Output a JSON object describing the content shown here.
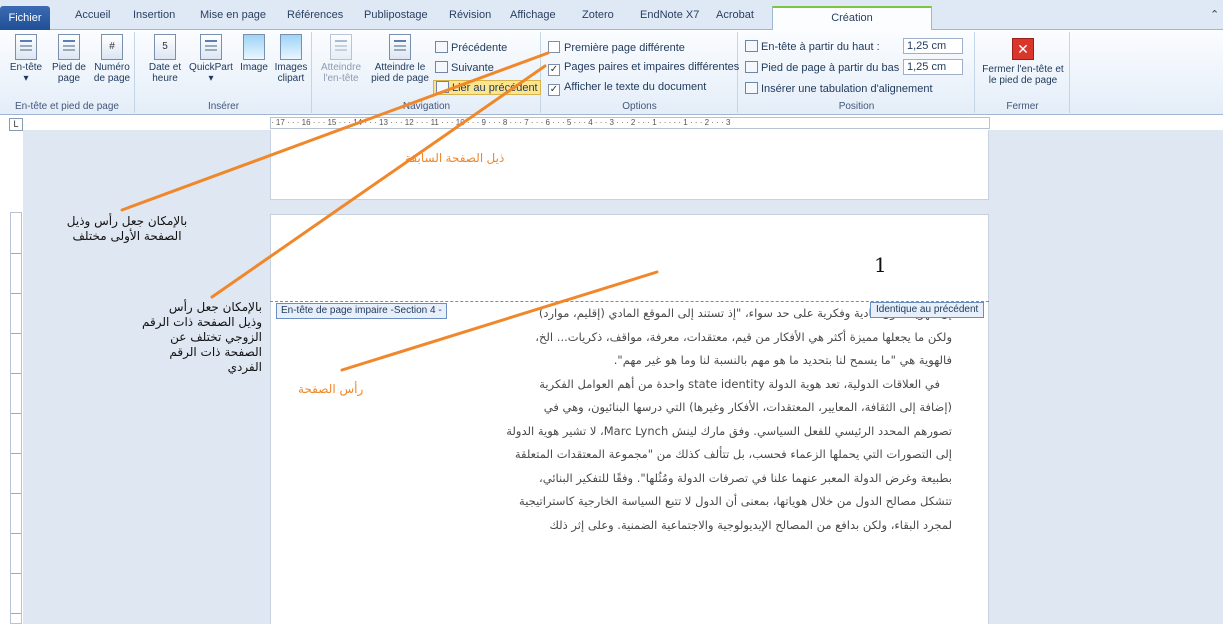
{
  "tabs": {
    "file": "Fichier",
    "items": [
      "Accueil",
      "Insertion",
      "Mise en page",
      "Références",
      "Publipostage",
      "Révision",
      "Affichage",
      "Zotero",
      "EndNote X7",
      "Acrobat"
    ],
    "active": "Création"
  },
  "ribbon": {
    "group_header_footer": {
      "title": "En-tête et pied de page",
      "header": "En-tête",
      "footer": "Pied de page",
      "page_number": "Numéro de page"
    },
    "group_insert": {
      "title": "Insérer",
      "date_time": "Date et heure",
      "quickpart": "QuickPart",
      "image": "Image",
      "clipart": "Images clipart"
    },
    "group_navigation": {
      "title": "Navigation",
      "goto_header": "Atteindre l'en-tête",
      "goto_footer": "Atteindre le pied de page",
      "previous": "Précédente",
      "next": "Suivante",
      "link_previous": "Lier au précédent"
    },
    "group_options": {
      "title": "Options",
      "different_first_page": "Première page différente",
      "different_odd_even": "Pages paires et impaires différentes",
      "show_document_text": "Afficher le texte du document",
      "different_first_page_checked": false,
      "different_odd_even_checked": true,
      "show_document_text_checked": true
    },
    "group_position": {
      "title": "Position",
      "header_from_top_label": "En-tête à partir du haut :",
      "header_from_top_value": "1,25 cm",
      "footer_from_bottom_label": "Pied de page à partir du bas :",
      "footer_from_bottom_value": "1,25 cm",
      "insert_alignment_tab": "Insérer une tabulation d'alignement"
    },
    "group_close": {
      "title": "Fermer",
      "close_header_footer": "Fermer l'en-tête et le pied de page"
    }
  },
  "ruler": {
    "horizontal": "· 17 · · · 16 · · · 15 · · · 14 · · · 13 · · · 12 · · · 11 · · · 10 · · · 9 · · · 8 · · · 7 · · · 6 · · · 5 · · · 4 · · · 3 · · · 2 · · · 1 · · · · · 1 · · · 2 · · · 3"
  },
  "document": {
    "previous_footer": "ذيل الصفحة السابقة",
    "page_number": "1",
    "header_tag": "En-tête de page impaire -Section 4 -",
    "same_as_previous": "Identique au précédent",
    "paragraph_lines": [
      "إن الهوية تكون مادية وفكرية على حد سواء، \"إذ تستند إلى الموقع المادي (إقليم، موارد)",
      "ولكن ما يجعلها مميزة أكثر هي الأفكار من قيم، معتقدات، معرفة، مواقف، ذكريات... الخ،",
      "فالهوية هي \"ما يسمح لنا بتحديد ما هو مهم بالنسبة لنا وما هو غير مهم\".",
      "في العلاقات الدولية، تعد هوية الدولة state identity واحدة من أهم العوامل الفكرية",
      "(إضافة إلى الثقافة، المعايير، المعتقدات، الأفكار وغيرها) التي درسها البنائيون، وهي في",
      "تصورهم المحدد الرئيسي للفعل السياسي. وفق مارك لينش Marc Lynch، لا تشير هوية الدولة",
      "إلى التصورات التي يحملها الزعماء فحسب، بل تتألف كذلك من \"مجموعة المعتقدات المتعلقة",
      "بطبيعة وغرض الدولة المعبر عنهما علنا في تصرفات الدولة ومُثُلها\". وفقًا للتفكير البنائي،",
      "تتشكل مصالح الدول من خلال هوياتها، بمعنى أن الدول لا تتبع السياسة الخارجية كاستراتيجية",
      "لمجرد البقاء، ولكن بدافع من المصالح الإيديولوجية والاجتماعية الضمنية. وعلى إثر ذلك"
    ]
  },
  "annotations": {
    "first_page_note": "بالإمكان جعل رأس وذيل الصفحة الأولى مختلف",
    "odd_even_note": "بالإمكان جعل رأس وذيل الصفحة ذات الرقم الزوجي تختلف عن الصفحة ذات الرقم الفردي",
    "header_label": "رأس الصفحة",
    "line_color": "#f0882b"
  }
}
